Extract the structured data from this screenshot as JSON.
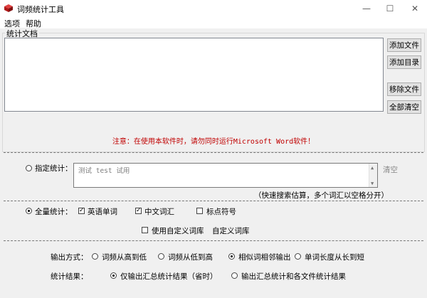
{
  "window": {
    "title": "词频统计工具",
    "minimize_glyph": "—",
    "maximize_glyph": "☐",
    "close_glyph": "✕"
  },
  "menu": {
    "items": [
      "选项",
      "帮助"
    ]
  },
  "docs_group": {
    "label": "统计文档",
    "buttons": [
      "添加文件",
      "添加目录",
      "移除文件",
      "全部清空"
    ]
  },
  "notice": "注意：在使用本软件时，请勿同时运行Microsoft Word软件！",
  "specified": {
    "label": "指定统计：",
    "selected": false,
    "placeholder": "测试 test 试用",
    "clear_label": "清空",
    "hint": "（快速搜索估算，多个词汇以空格分开）"
  },
  "full": {
    "label": "全量统计：",
    "selected": true,
    "options": [
      {
        "label": "英语单词",
        "checked": true
      },
      {
        "label": "中文词汇",
        "checked": true
      },
      {
        "label": "标点符号",
        "checked": false
      }
    ],
    "custom_lexicon": {
      "label": "使用自定义词库",
      "checked": false
    },
    "custom_lexicon_link": "自定义词库"
  },
  "output": {
    "label": "输出方式：",
    "options": [
      {
        "label": "词频从高到低",
        "selected": false
      },
      {
        "label": "词频从低到高",
        "selected": false
      },
      {
        "label": "相似词相邻输出",
        "selected": true
      },
      {
        "label": "单词长度从长到短",
        "selected": false
      }
    ]
  },
  "result": {
    "label": "统计结果：",
    "options": [
      {
        "label": "仅输出汇总统计结果（省时）",
        "selected": true
      },
      {
        "label": "输出汇总统计和各文件统计结果",
        "selected": false
      }
    ]
  },
  "colors": {
    "notice": "#c00000",
    "background": "#f0f0f0"
  }
}
